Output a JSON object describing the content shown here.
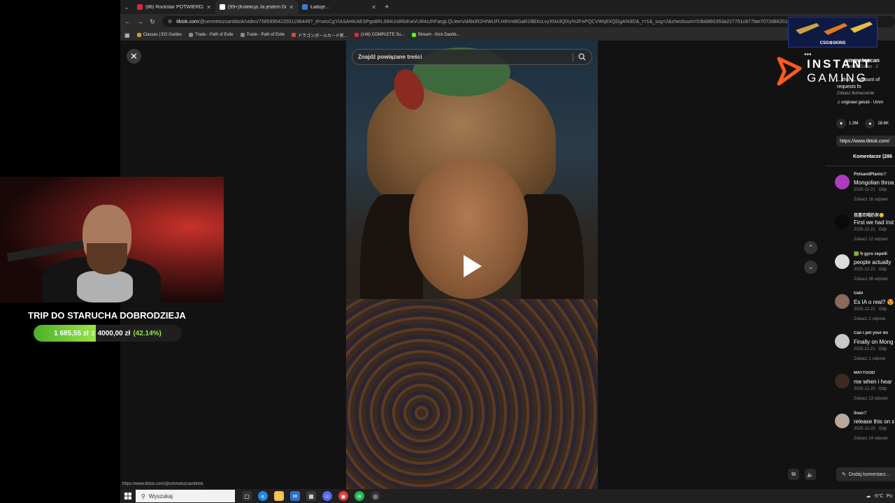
{
  "browser": {
    "tabs": [
      {
        "title": "(86) Rockstar POTWIERDZIŁ W",
        "favicon_color": "#e0263a",
        "active": false
      },
      {
        "title": "(99+)Kolekcja Ja jestem Diabe",
        "favicon_color": "#ffffff",
        "active": true
      },
      {
        "title": "Ładuje...",
        "favicon_color": "#3a7bd5",
        "active": false
      }
    ],
    "new_tab": "+",
    "url_host": "tiktok.com",
    "url_rest": "/@ummetozcantiktok/video/7585995423551196449?_d=secCgYIASAHKAESPgo8RL084UnIRkIKwVUR4zzhFasgLQUemVd4b0R2HIWUFLH6Vnt8GaR1fBlXcLvyXNx3QlXy%2FePQCVWq9XQGgA%3D&_r=1&_svg=2&checksum=53b6860353a227751c877fae7072d86201494ac64b",
    "bookmarks": [
      {
        "label": "Classes | EO Guides",
        "color": "#c89a3a"
      },
      {
        "label": "Trade - Path of Exile",
        "color": "#888888"
      },
      {
        "label": "Trade - Path of Exile",
        "color": "#888888"
      },
      {
        "label": "ドラゴンボールカード新...",
        "color": "#d94a3a"
      },
      {
        "label": "(146) COMPLETE Su...",
        "color": "#e0263a"
      },
      {
        "label": "Stream - Kick Dashb...",
        "color": "#53fc18"
      }
    ],
    "status_url": "https://www.tiktok.com/@ummetozcantiktok"
  },
  "tiktok": {
    "search_placeholder": "Znajdź powiązane treści",
    "author": "ummetozcan",
    "author_sub": "Ümmet Özcan · 2",
    "description": "... this j... amount of requests fo",
    "translate": "Zobacz tłumaczenie",
    "music": "origineel geluid - Umm",
    "likes": "1.3M",
    "comments_count": "28.6K",
    "share_link": "https://www.tiktok.com/",
    "comments_tab": "Komentarze (286",
    "add_comment": "Dodaj komentarz...",
    "comments": [
      {
        "user": "PotsandPlants♡",
        "text": "Mongolian throa 😍",
        "date": "2025-12-21",
        "reply_label": "Odp",
        "replies": "Zobacz 16 odpowi",
        "avatar_color": "#b03ac4"
      },
      {
        "user": "我喜欢喝奶茶😊",
        "text": "First we had Ind Mongolian versi",
        "date": "2025-12-21",
        "reply_label": "Odp",
        "replies": "Zobacz 12 odpowi",
        "avatar_color": "#0a0a0a"
      },
      {
        "user": "🟩🐐gyro zepelli",
        "text": "people actually",
        "date": "2025-12-21",
        "reply_label": "Odp",
        "replies": "Zobacz 36 odpowi",
        "avatar_color": "#dcdcdc"
      },
      {
        "user": "Gabi",
        "text": "Es IA o real? 😍",
        "date": "2025-12-21",
        "reply_label": "Odp",
        "replies": "Zobacz 2 odpowi",
        "avatar_color": "#8a6a5a"
      },
      {
        "user": "Can I pet your do",
        "text": "Finally on Mong",
        "date": "2025-12-21",
        "reply_label": "Odp",
        "replies": "Zobacz 1 odpowi",
        "avatar_color": "#c8c8c8"
      },
      {
        "user": "MATYGOD",
        "text": "me when i hear",
        "date": "2025-12-20",
        "reply_label": "Odp",
        "replies": "Zobacz 13 odpowi",
        "avatar_color": "#3a2a20"
      },
      {
        "user": "linas♡",
        "text": "release this on s",
        "date": "2025-12-20",
        "reply_label": "Odp",
        "replies": "Zobacz 14 odpowi",
        "avatar_color": "#b8a89a"
      }
    ]
  },
  "overlay": {
    "instant_gaming_line1": "INSTANT",
    "instant_gaming_line2": "GAMING",
    "csg_label": "CSG⚙SKINS",
    "trip_title": "TRIP DO STARUCHA DOBRODZIEJA",
    "trip_current": "1 685,55 zł",
    "trip_separator": "z",
    "trip_goal": "4000,00 zł",
    "trip_percent_label": "(42.14%)",
    "trip_progress": 0.4214
  },
  "taskbar": {
    "search_placeholder": "Wyszukaj",
    "temperature": "-5°C",
    "weather_suffix": "Po"
  },
  "colors": {
    "accent_orange": "#ff5a1f",
    "progress_green": "#9be34a"
  }
}
